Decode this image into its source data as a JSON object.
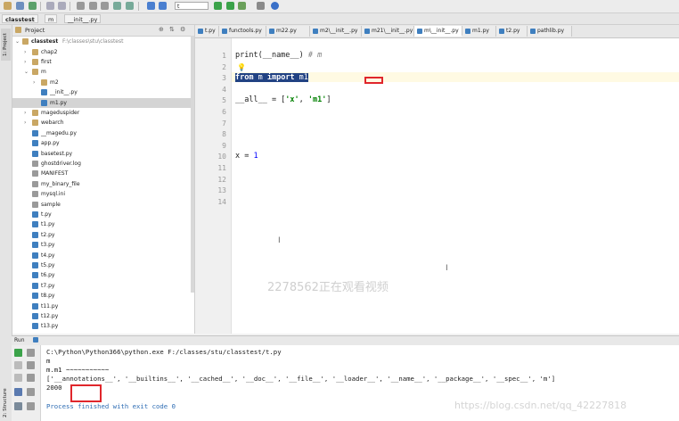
{
  "toolbar": {
    "run_config": "t",
    "icons": [
      "open-folder-icon",
      "save-icon",
      "sync-icon",
      "undo-icon",
      "redo-icon",
      "cut-icon",
      "copy-icon",
      "paste-icon",
      "find-icon",
      "replace-icon",
      "back-icon",
      "forward-icon",
      "run-icon",
      "debug-icon",
      "coverage-icon",
      "settings-icon",
      "help-icon"
    ]
  },
  "breadcrumb": [
    "classtest",
    "m",
    "__init__.py"
  ],
  "left_strip": {
    "project_tab": "1: Project",
    "structure_tab": "2: Structure"
  },
  "project": {
    "header": "Project",
    "root_name": "classtest",
    "root_path": "F:\\classes\\stu\\classtest",
    "items": [
      {
        "label": "chap2",
        "type": "folder",
        "indent": 1,
        "arrow": "right"
      },
      {
        "label": "first",
        "type": "folder",
        "indent": 1,
        "arrow": "right"
      },
      {
        "label": "m",
        "type": "folder",
        "indent": 1,
        "arrow": "down"
      },
      {
        "label": "m2",
        "type": "folder",
        "indent": 2,
        "arrow": "right"
      },
      {
        "label": "__init__.py",
        "type": "py",
        "indent": 2,
        "arrow": ""
      },
      {
        "label": "m1.py",
        "type": "py",
        "indent": 2,
        "arrow": "",
        "selected": true
      },
      {
        "label": "mageduspider",
        "type": "folder",
        "indent": 1,
        "arrow": "right"
      },
      {
        "label": "webarch",
        "type": "folder",
        "indent": 1,
        "arrow": "right"
      },
      {
        "label": "__magedu.py",
        "type": "py",
        "indent": 1,
        "arrow": ""
      },
      {
        "label": "app.py",
        "type": "py",
        "indent": 1,
        "arrow": ""
      },
      {
        "label": "basetest.py",
        "type": "py",
        "indent": 1,
        "arrow": ""
      },
      {
        "label": "ghostdriver.log",
        "type": "txt",
        "indent": 1,
        "arrow": ""
      },
      {
        "label": "MANIFEST",
        "type": "txt",
        "indent": 1,
        "arrow": ""
      },
      {
        "label": "my_binary_file",
        "type": "txt",
        "indent": 1,
        "arrow": ""
      },
      {
        "label": "mysql.ini",
        "type": "txt",
        "indent": 1,
        "arrow": ""
      },
      {
        "label": "sample",
        "type": "txt",
        "indent": 1,
        "arrow": ""
      },
      {
        "label": "t.py",
        "type": "py",
        "indent": 1,
        "arrow": ""
      },
      {
        "label": "t1.py",
        "type": "py",
        "indent": 1,
        "arrow": ""
      },
      {
        "label": "t2.py",
        "type": "py",
        "indent": 1,
        "arrow": ""
      },
      {
        "label": "t3.py",
        "type": "py",
        "indent": 1,
        "arrow": ""
      },
      {
        "label": "t4.py",
        "type": "py",
        "indent": 1,
        "arrow": ""
      },
      {
        "label": "t5.py",
        "type": "py",
        "indent": 1,
        "arrow": ""
      },
      {
        "label": "t6.py",
        "type": "py",
        "indent": 1,
        "arrow": ""
      },
      {
        "label": "t7.py",
        "type": "py",
        "indent": 1,
        "arrow": ""
      },
      {
        "label": "t8.py",
        "type": "py",
        "indent": 1,
        "arrow": ""
      },
      {
        "label": "t11.py",
        "type": "py",
        "indent": 1,
        "arrow": ""
      },
      {
        "label": "t12.py",
        "type": "py",
        "indent": 1,
        "arrow": ""
      },
      {
        "label": "t13.py",
        "type": "py",
        "indent": 1,
        "arrow": ""
      }
    ]
  },
  "editor": {
    "tabs": [
      "t.py",
      "functools.py",
      "m22.py",
      "m2\\__init__.py",
      "m21\\__init__.py",
      "m\\__init__.py",
      "m1.py",
      "t2.py",
      "pathlib.py"
    ],
    "active_tab": 5,
    "line_numbers": [
      "1",
      "2",
      "3",
      "4",
      "5",
      "6",
      "7",
      "8",
      "9",
      "10",
      "11",
      "12",
      "13",
      "14"
    ],
    "line1_func": "print",
    "line1_args": "(__name__) ",
    "line1_comment": "# m",
    "line3_from": "from",
    "line3_mid": " m ",
    "line3_import": "import",
    "line3_tail": " m1",
    "line5_a": "__all__ = [",
    "line5_s1": "'x'",
    "line5_b": ", ",
    "line5_s2": "'m1'",
    "line5_c": "]",
    "line10_a": "x = ",
    "line10_num": "1",
    "watermark": "2278562正在观看视频"
  },
  "run": {
    "header": "Run",
    "lines": [
      "C:\\Python\\Python366\\python.exe F:/classes/stu/classtest/t.py",
      "m",
      "m.m1 ~~~~~~~~~~~",
      "['__annotations__', '__builtins__', '__cached__', '__doc__', '__file__', '__loader__', '__name__', '__package__', '__spec__', 'm']",
      "2000",
      "",
      "Process finished with exit code 0"
    ],
    "credit": "https://blog.csdn.net/qq_42227818"
  },
  "colors": {
    "selection": "#214283",
    "keyword": "#000080",
    "string": "#008000",
    "number": "#0000ff",
    "highlight_box": "#e0262b"
  }
}
